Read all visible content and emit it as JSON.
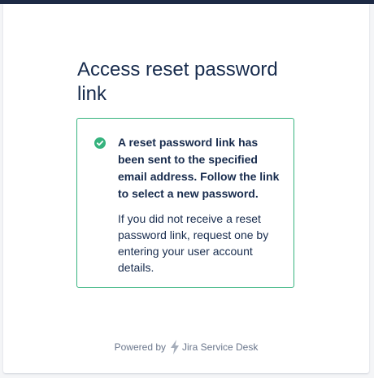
{
  "page": {
    "title": "Access reset password link"
  },
  "message": {
    "status_icon": "check-circle-icon",
    "status_color": "#36b37e",
    "bold_text": "A reset password link has been sent to the specified email address. Follow the link to select a new password.",
    "normal_text": "If you did not receive a reset password link, request one by entering your user account details."
  },
  "footer": {
    "powered_by": "Powered by",
    "logo_icon": "jira-bolt-icon",
    "product": "Jira Service Desk"
  },
  "colors": {
    "top_bar": "#1d2a45",
    "text": "#172b4d",
    "muted": "#6b778c",
    "success": "#36b37e"
  }
}
